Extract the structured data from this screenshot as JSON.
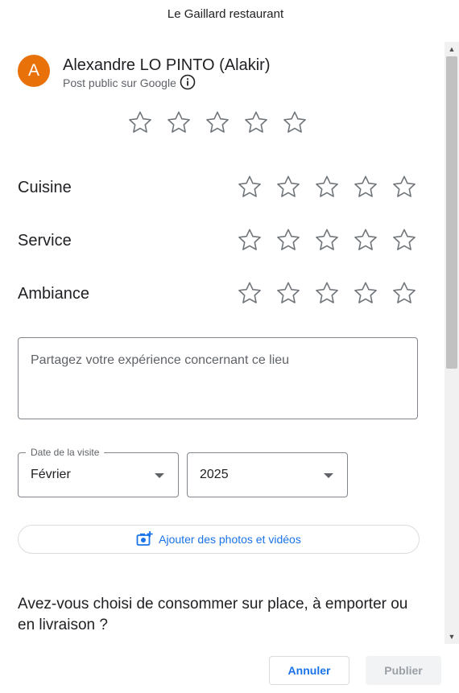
{
  "dialog": {
    "title": "Le Gaillard restaurant"
  },
  "user": {
    "avatar_letter": "A",
    "avatar_color": "#e8710a",
    "name": "Alexandre LO PINTO (Alakir)",
    "post_visibility": "Post public sur Google",
    "info_icon": "info-icon"
  },
  "overall_rating": {
    "stars": 5,
    "selected": 0
  },
  "categories": [
    {
      "label": "Cuisine",
      "stars": 5,
      "selected": 0
    },
    {
      "label": "Service",
      "stars": 5,
      "selected": 0
    },
    {
      "label": "Ambiance",
      "stars": 5,
      "selected": 0
    }
  ],
  "review": {
    "placeholder": "Partagez votre expérience concernant ce lieu",
    "value": ""
  },
  "visit_date": {
    "label": "Date de la visite",
    "month": "Février",
    "year": "2025"
  },
  "media": {
    "label": "Ajouter des photos et vidéos",
    "icon": "add-photo-icon"
  },
  "question": "Avez-vous choisi de consommer sur place, à emporter ou en livraison ?",
  "actions": {
    "cancel": "Annuler",
    "publish": "Publier"
  },
  "colors": {
    "accent": "#1a73e8",
    "star_outline": "#70757a",
    "disabled_bg": "#f1f3f4",
    "disabled_text": "#9aa0a6"
  }
}
